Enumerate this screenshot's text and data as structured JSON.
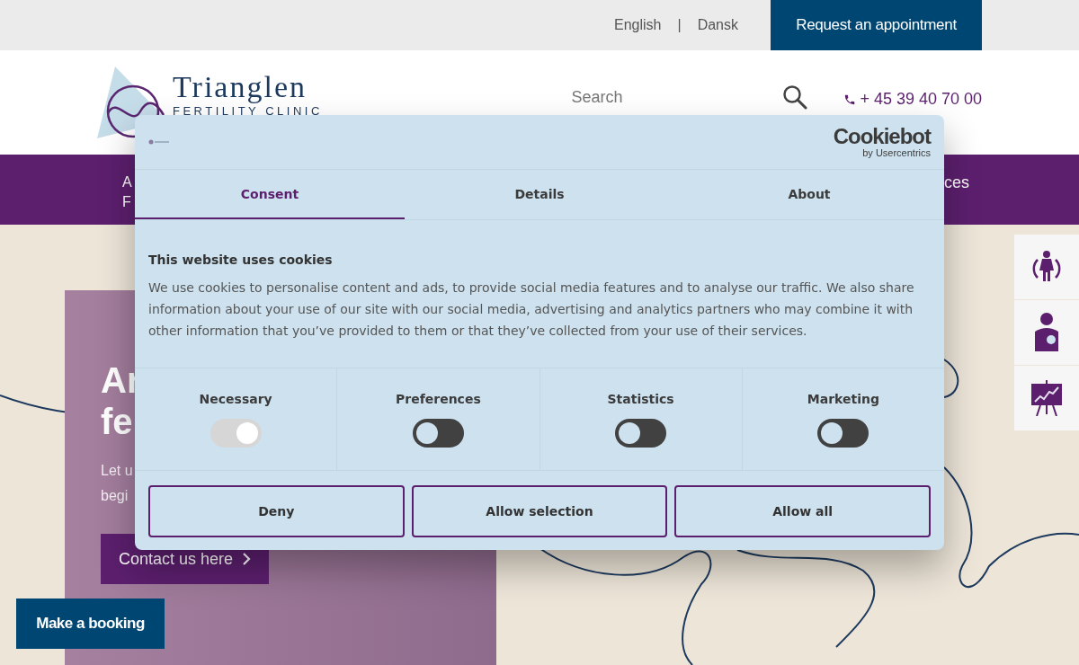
{
  "top_bar": {
    "languages": [
      "English",
      "Dansk"
    ],
    "language_separator": "|",
    "request_button": "Request an appointment"
  },
  "header": {
    "logo": {
      "name": "Trianglen",
      "tagline": "FERTILITY CLINIC"
    },
    "search": {
      "placeholder": "Search"
    },
    "phone": "+ 45 39 40 70 00"
  },
  "nav": {
    "items": [
      {
        "lines": [
          "A",
          "F"
        ]
      },
      {
        "lines": [
          "ces"
        ]
      }
    ]
  },
  "hero": {
    "heading_lines": [
      "Ar",
      "fe"
    ],
    "text_lines": [
      "Let u",
      "begi"
    ],
    "button": "Contact us here"
  },
  "booking_button": "Make a booking",
  "cookie_dialog": {
    "brand": "Cookiebot",
    "brand_sub": "by Usercentrics",
    "tabs": [
      {
        "label": "Consent",
        "selected": true
      },
      {
        "label": "Details",
        "selected": false
      },
      {
        "label": "About",
        "selected": false
      }
    ],
    "title": "This website uses cookies",
    "text": "We use cookies to personalise content and ads, to provide social media features and to analyse our traffic. We also share information about your use of our site with our social media, advertising and analytics partners who may combine it with other information that you’ve provided to them or that they’ve collected from your use of their services.",
    "categories": [
      {
        "label": "Necessary",
        "checked": true,
        "disabled": true
      },
      {
        "label": "Preferences",
        "checked": false,
        "disabled": false
      },
      {
        "label": "Statistics",
        "checked": false,
        "disabled": false
      },
      {
        "label": "Marketing",
        "checked": false,
        "disabled": false
      }
    ],
    "buttons": [
      "Deny",
      "Allow selection",
      "Allow all"
    ]
  }
}
